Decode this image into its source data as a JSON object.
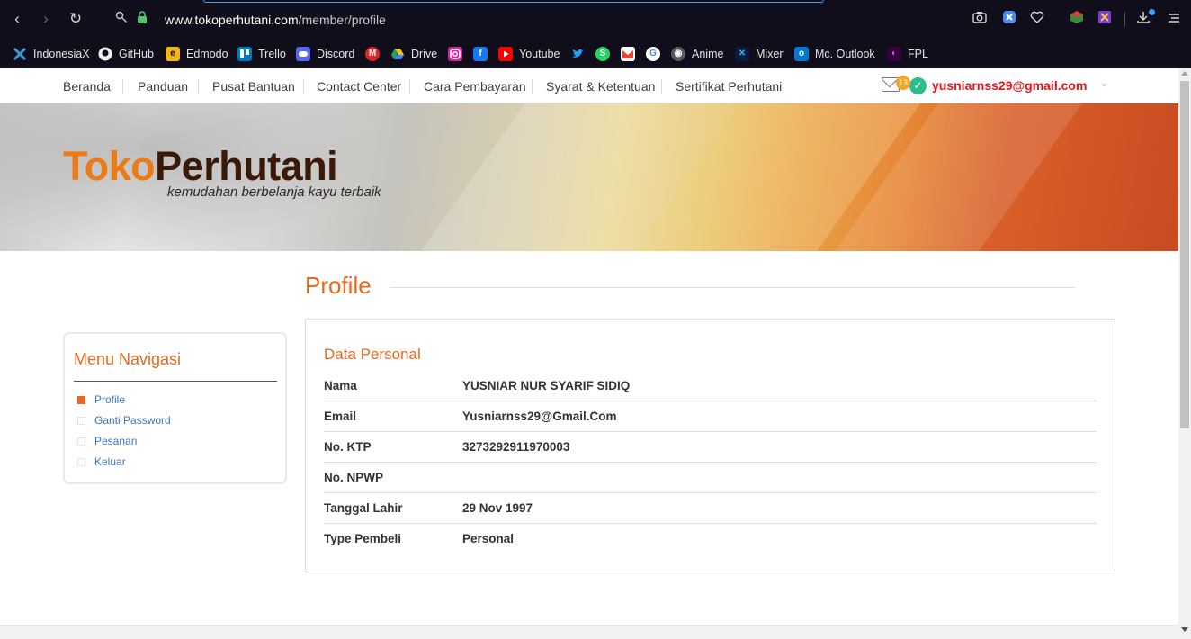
{
  "browser": {
    "url_domain": "www.tokoperhutani.com",
    "url_path": "/member/profile",
    "nav": {
      "back": "‹",
      "forward": "›",
      "reload": "↻"
    },
    "bookmarks": [
      {
        "label": "IndonesiaX",
        "icon": "indonesiax-icon",
        "color": "#3b6fd8"
      },
      {
        "label": "GitHub",
        "icon": "github-icon",
        "color": "#f0f0f0"
      },
      {
        "label": "Edmodo",
        "icon": "edmodo-icon",
        "color": "#f2b51f"
      },
      {
        "label": "Trello",
        "icon": "trello-icon",
        "color": "#0079bf"
      },
      {
        "label": "Discord",
        "icon": "discord-icon",
        "color": "#5865f2"
      },
      {
        "label": "",
        "icon": "mega-icon",
        "color": "#d9272e"
      },
      {
        "label": "Drive",
        "icon": "drive-icon",
        "color": "#1fa463"
      },
      {
        "label": "",
        "icon": "instagram-icon",
        "color": "#d6249f"
      },
      {
        "label": "",
        "icon": "facebook-icon",
        "color": "#1877f2"
      },
      {
        "label": "Youtube",
        "icon": "youtube-icon",
        "color": "#ff0000"
      },
      {
        "label": "",
        "icon": "twitter-icon",
        "color": "#1da1f2"
      },
      {
        "label": "",
        "icon": "whatsapp-icon",
        "color": "#25d366"
      },
      {
        "label": "",
        "icon": "gmail-icon",
        "color": "#ea4335"
      },
      {
        "label": "",
        "icon": "google-icon",
        "color": "#ffffff"
      },
      {
        "label": "Anime",
        "icon": "anime-icon",
        "color": "#9a9a9a"
      },
      {
        "label": "Mixer",
        "icon": "mixer-icon",
        "color": "#1fbaed"
      },
      {
        "label": "Mc. Outlook",
        "icon": "outlook-icon",
        "color": "#0078d4"
      },
      {
        "label": "FPL",
        "icon": "fpl-icon",
        "color": "#38003c"
      }
    ]
  },
  "site": {
    "menu": [
      "Beranda",
      "Panduan",
      "Pusat Bantuan",
      "Contact Center",
      "Cara Pembayaran",
      "Syarat & Ketentuan",
      "Sertifikat Perhutani"
    ],
    "notification_count": "13",
    "user_email": "yusniarnss29@gmail.com",
    "logo_part1": "Toko",
    "logo_part2": "Perhutani",
    "tagline": "kemudahan berbelanja kayu terbaik"
  },
  "page": {
    "title": "Profile",
    "sidebar": {
      "title": "Menu Navigasi",
      "items": [
        "Profile",
        "Ganti Password",
        "Pesanan",
        "Keluar"
      ],
      "active_index": 0
    },
    "section_title": "Data Personal",
    "fields": [
      {
        "label": "Nama",
        "value": "YUSNIAR NUR SYARIF SIDIQ"
      },
      {
        "label": "Email",
        "value": "Yusniarnss29@Gmail.Com"
      },
      {
        "label": "No. KTP",
        "value": "3273292911970003"
      },
      {
        "label": "No. NPWP",
        "value": ""
      },
      {
        "label": "Tanggal Lahir",
        "value": "29 Nov 1997"
      },
      {
        "label": "Type Pembeli",
        "value": "Personal"
      }
    ]
  },
  "colors": {
    "accent": "#e8681f",
    "email_red": "#e8141c",
    "link_blue": "#3c78b4",
    "chrome_bg": "#0f0e1a"
  }
}
